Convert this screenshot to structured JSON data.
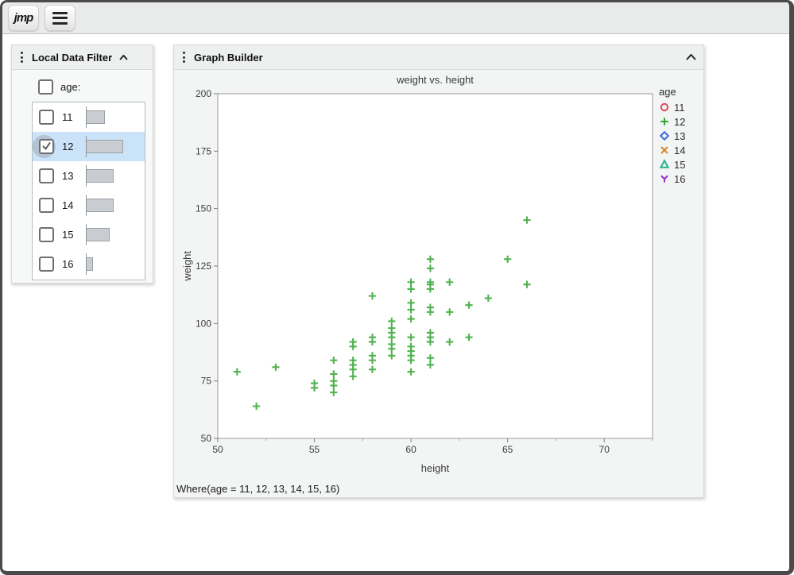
{
  "topbar": {
    "logo_text": "jmp"
  },
  "filter_panel": {
    "title": "Local Data Filter",
    "field_label": "age:",
    "field_checked": false,
    "highlight_color": "#cbe3f8",
    "rows": [
      {
        "label": "11",
        "checked": false,
        "bar": 22
      },
      {
        "label": "12",
        "checked": true,
        "bar": 45
      },
      {
        "label": "13",
        "checked": false,
        "bar": 33
      },
      {
        "label": "14",
        "checked": false,
        "bar": 33
      },
      {
        "label": "15",
        "checked": false,
        "bar": 28
      },
      {
        "label": "16",
        "checked": false,
        "bar": 7
      }
    ]
  },
  "graph_panel": {
    "title": "Graph Builder",
    "where_text": "Where(age = 11, 12, 13, 14, 15, 16)"
  },
  "chart_data": {
    "type": "scatter",
    "title": "weight vs. height",
    "xlabel": "height",
    "ylabel": "weight",
    "xlim": [
      50,
      72.5
    ],
    "ylim": [
      50,
      200
    ],
    "x_major_ticks": [
      50,
      55,
      60,
      65,
      70
    ],
    "x_minor_ticks": [
      52.5,
      57.5,
      62.5,
      67.5,
      72.5
    ],
    "y_major_ticks": [
      50,
      75,
      100,
      125,
      150,
      175,
      200
    ],
    "grid": false,
    "legend_title": "age",
    "legend_position": "right",
    "series": [
      {
        "name": "11",
        "marker": "circle",
        "color": "#e04a56",
        "points": []
      },
      {
        "name": "12",
        "marker": "plus",
        "color": "#33a532",
        "points": [
          [
            51,
            79
          ],
          [
            52,
            64
          ],
          [
            53,
            81
          ],
          [
            55,
            74
          ],
          [
            55,
            72
          ],
          [
            56,
            84
          ],
          [
            56,
            78
          ],
          [
            56,
            75
          ],
          [
            56,
            73
          ],
          [
            56,
            70
          ],
          [
            57,
            92
          ],
          [
            57,
            90
          ],
          [
            57,
            84
          ],
          [
            57,
            82
          ],
          [
            57,
            80
          ],
          [
            57,
            77
          ],
          [
            58,
            112
          ],
          [
            58,
            94
          ],
          [
            58,
            92
          ],
          [
            58,
            86
          ],
          [
            58,
            84
          ],
          [
            58,
            80
          ],
          [
            59,
            101
          ],
          [
            59,
            98
          ],
          [
            59,
            96
          ],
          [
            59,
            94
          ],
          [
            59,
            91
          ],
          [
            59,
            89
          ],
          [
            59,
            86
          ],
          [
            60,
            118
          ],
          [
            60,
            115
          ],
          [
            60,
            109
          ],
          [
            60,
            106
          ],
          [
            60,
            102
          ],
          [
            60,
            94
          ],
          [
            60,
            90
          ],
          [
            60,
            88
          ],
          [
            60,
            86
          ],
          [
            60,
            84
          ],
          [
            60,
            79
          ],
          [
            61,
            128
          ],
          [
            61,
            124
          ],
          [
            61,
            118
          ],
          [
            61,
            117
          ],
          [
            61,
            115
          ],
          [
            61,
            107
          ],
          [
            61,
            105
          ],
          [
            61,
            96
          ],
          [
            61,
            94
          ],
          [
            61,
            92
          ],
          [
            61,
            85
          ],
          [
            61,
            82
          ],
          [
            62,
            118
          ],
          [
            62,
            105
          ],
          [
            62,
            92
          ],
          [
            63,
            108
          ],
          [
            63,
            94
          ],
          [
            64,
            111
          ],
          [
            65,
            128
          ],
          [
            66,
            145
          ],
          [
            66,
            117
          ]
        ]
      },
      {
        "name": "13",
        "marker": "diamond",
        "color": "#3b6be0",
        "points": []
      },
      {
        "name": "14",
        "marker": "x",
        "color": "#d8821f",
        "points": []
      },
      {
        "name": "15",
        "marker": "triangle",
        "color": "#27b089",
        "points": []
      },
      {
        "name": "16",
        "marker": "y",
        "color": "#9233cc",
        "points": []
      }
    ]
  }
}
